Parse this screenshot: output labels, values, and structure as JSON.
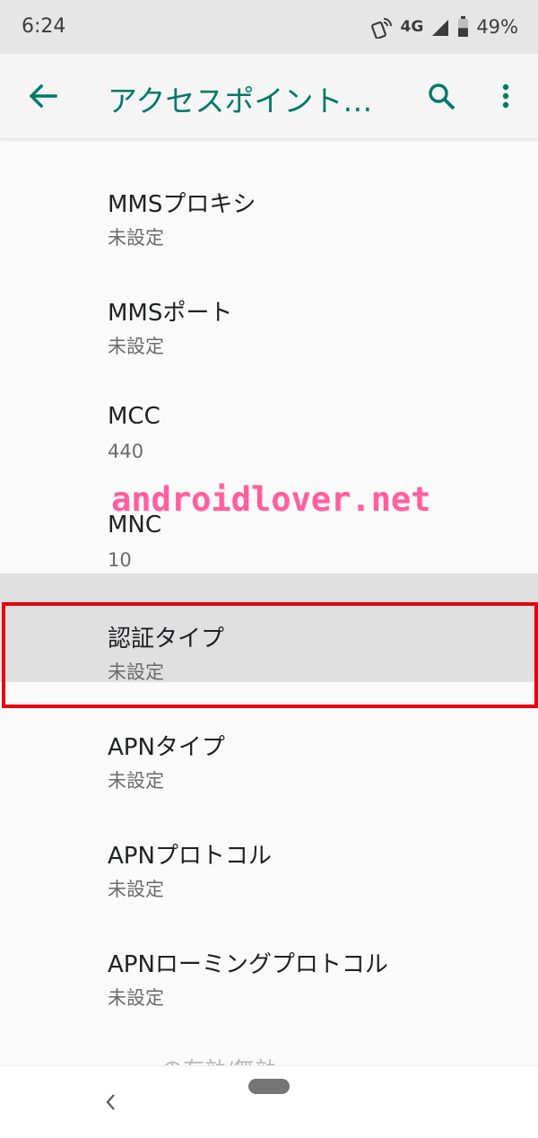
{
  "status_bar": {
    "time": "6:24",
    "network": "4G",
    "battery_percent": "49%",
    "battery_level": 0.49,
    "icons": [
      "wifi-calling-icon",
      "signal-icon",
      "battery-icon"
    ]
  },
  "app_bar": {
    "title": "アクセスポイント…",
    "accent_color": "#00796b",
    "icons": [
      "back-arrow-icon",
      "search-icon",
      "more-vert-icon"
    ]
  },
  "preferences": [
    {
      "title": "MMSプロキシ",
      "summary": "未設定"
    },
    {
      "title": "MMSポート",
      "summary": "未設定"
    },
    {
      "title": "MCC",
      "summary": "440"
    },
    {
      "title": "MNC",
      "summary": "10"
    },
    {
      "title": "認証タイプ",
      "summary": "未設定"
    },
    {
      "title": "APNタイプ",
      "summary": "未設定"
    },
    {
      "title": "APNプロトコル",
      "summary": "未設定"
    },
    {
      "title": "APNローミングプロトコル",
      "summary": "未設定"
    }
  ],
  "partial_item_text": "の有効/無効",
  "watermark": "androidlover.net",
  "highlight_color": "#e60012",
  "nav_bar": {
    "icons": [
      "nav-back-icon",
      "home-pill"
    ]
  }
}
